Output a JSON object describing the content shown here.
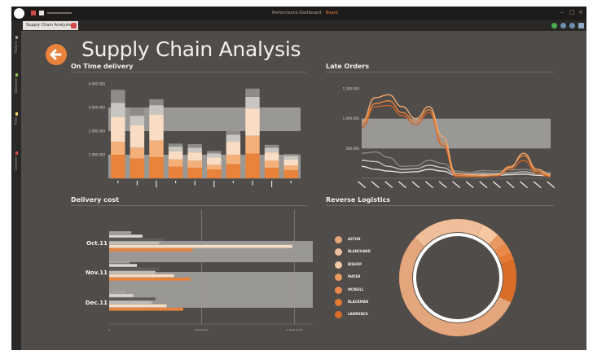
{
  "window": {
    "title": "Performance Dashboard",
    "title_accent": "Board",
    "active_tab": "Supply Chain Analysis"
  },
  "sidebar": {
    "items": [
      {
        "label": "Historic",
        "color": "#9e9a96"
      },
      {
        "label": "Uploaded",
        "color": "#8bc34a"
      },
      {
        "label": "Print",
        "color": "#e8d36a"
      },
      {
        "label": "Contacts",
        "color": "#d44a4a"
      }
    ]
  },
  "page": {
    "title": "Supply Chain Analysis"
  },
  "panels": {
    "on_time": {
      "title": "On Time delivery"
    },
    "late_orders": {
      "title": "Late Orders"
    },
    "delivery_cost": {
      "title": "Delivery cost"
    },
    "reverse": {
      "title": "Reverse Logistics"
    }
  },
  "colors": {
    "background": "#4f4c49",
    "accent": "#e9823a",
    "band": "#9a9895",
    "light_orange": "#f6cba6"
  },
  "chart_data": [
    {
      "id": "on_time_delivery",
      "type": "bar",
      "stacked": true,
      "title": "On Time delivery",
      "y_ticks": [
        "4.000.000",
        "3.000.000",
        "2.000.000",
        "1.000.000"
      ],
      "ylim": [
        0,
        4000000
      ],
      "bands": [
        [
          2000000,
          3000000
        ],
        [
          0,
          1000000
        ]
      ],
      "categories": [
        "",
        "",
        "",
        "",
        "",
        "",
        "",
        "",
        "",
        ""
      ],
      "series": [
        {
          "values": [
            1000000,
            850000,
            900000,
            500000,
            450000,
            380000,
            600000,
            1050000,
            450000,
            350000
          ],
          "color": "#e9823a"
        },
        {
          "values": [
            550000,
            450000,
            700000,
            300000,
            300000,
            200000,
            400000,
            750000,
            300000,
            200000
          ],
          "color": "#f5b07a"
        },
        {
          "values": [
            1050000,
            950000,
            1100000,
            350000,
            350000,
            300000,
            550000,
            1150000,
            350000,
            250000
          ],
          "color": "#f8dcc3"
        },
        {
          "values": [
            600000,
            400000,
            400000,
            200000,
            200000,
            180000,
            300000,
            500000,
            200000,
            150000
          ],
          "color": "#c9c5c1"
        },
        {
          "values": [
            550000,
            350000,
            250000,
            120000,
            150000,
            100000,
            150000,
            350000,
            120000,
            80000
          ],
          "color": "#8f8b87"
        }
      ]
    },
    {
      "id": "late_orders",
      "type": "line",
      "title": "Late Orders",
      "y_ticks": [
        "1.500.000",
        "1.000.000",
        "500.000"
      ],
      "ylim": [
        0,
        1500000
      ],
      "bands": [
        [
          500000,
          1000000
        ]
      ],
      "categories": [
        "",
        "",
        "",
        "",
        "",
        "",
        "",
        "",
        "",
        "",
        "",
        "",
        "",
        "",
        ""
      ],
      "series": [
        {
          "values": [
            950000,
            1350000,
            1400000,
            1200000,
            1000000,
            1200000,
            700000,
            80000,
            60000,
            50000,
            60000,
            180000,
            420000,
            150000,
            60000
          ],
          "color": "#f0a871"
        },
        {
          "values": [
            900000,
            1250000,
            1300000,
            1100000,
            950000,
            1150000,
            600000,
            50000,
            40000,
            40000,
            60000,
            200000,
            380000,
            120000,
            40000
          ],
          "color": "#e9823a"
        },
        {
          "values": [
            850000,
            1200000,
            1220000,
            1050000,
            900000,
            1100000,
            550000,
            30000,
            30000,
            30000,
            40000,
            150000,
            300000,
            80000,
            30000
          ],
          "color": "#c8632a"
        },
        {
          "values": [
            420000,
            440000,
            350000,
            200000,
            210000,
            300000,
            250000,
            120000,
            100000,
            130000,
            120000,
            140000,
            150000,
            120000,
            100000
          ],
          "color": "#8c8884"
        },
        {
          "values": [
            300000,
            280000,
            200000,
            150000,
            160000,
            220000,
            180000,
            80000,
            70000,
            90000,
            80000,
            90000,
            110000,
            80000,
            70000
          ],
          "color": "#c6c2be"
        },
        {
          "values": [
            200000,
            150000,
            120000,
            100000,
            110000,
            150000,
            120000,
            50000,
            40000,
            60000,
            50000,
            60000,
            70000,
            50000,
            40000
          ],
          "color": "#e3dfdb"
        }
      ]
    },
    {
      "id": "delivery_cost",
      "type": "bar",
      "orientation": "horizontal",
      "title": "Delivery cost",
      "categories": [
        "Oct.11",
        "Nov.11",
        "Dec.11"
      ],
      "x_ticks": [
        "0",
        "500.000",
        "1.000.000"
      ],
      "xlim": [
        0,
        1100000
      ],
      "series": [
        {
          "values": [
            120000,
            110000,
            90000
          ],
          "color": "#a4a09c"
        },
        {
          "values": [
            180000,
            150000,
            130000
          ],
          "color": "#d8d4d0"
        },
        {
          "values": [
            300000,
            270000,
            250000
          ],
          "color": "#5d5a57"
        },
        {
          "values": [
            270000,
            250000,
            230000
          ],
          "color": "#c0bcb8"
        },
        {
          "values": [
            990000,
            350000,
            310000
          ],
          "color": "#f8dcc3"
        },
        {
          "values": [
            450000,
            440000,
            400000
          ],
          "color": "#e9823a"
        }
      ]
    },
    {
      "id": "reverse_logistics",
      "type": "pie",
      "donut": true,
      "title": "Reverse Logistics",
      "labels": [
        "ASTON",
        "BLANCHARD",
        "BISHOP",
        "MAYER",
        "MCNEILL",
        "BLACKMAN",
        "LAWRENCE"
      ],
      "values": [
        55,
        20,
        5,
        3,
        3,
        2,
        12
      ],
      "colors": [
        "#e3a67d",
        "#efbf9b",
        "#f5c7a2",
        "#e99a63",
        "#e98a4a",
        "#e57a35",
        "#d96c26"
      ]
    }
  ]
}
